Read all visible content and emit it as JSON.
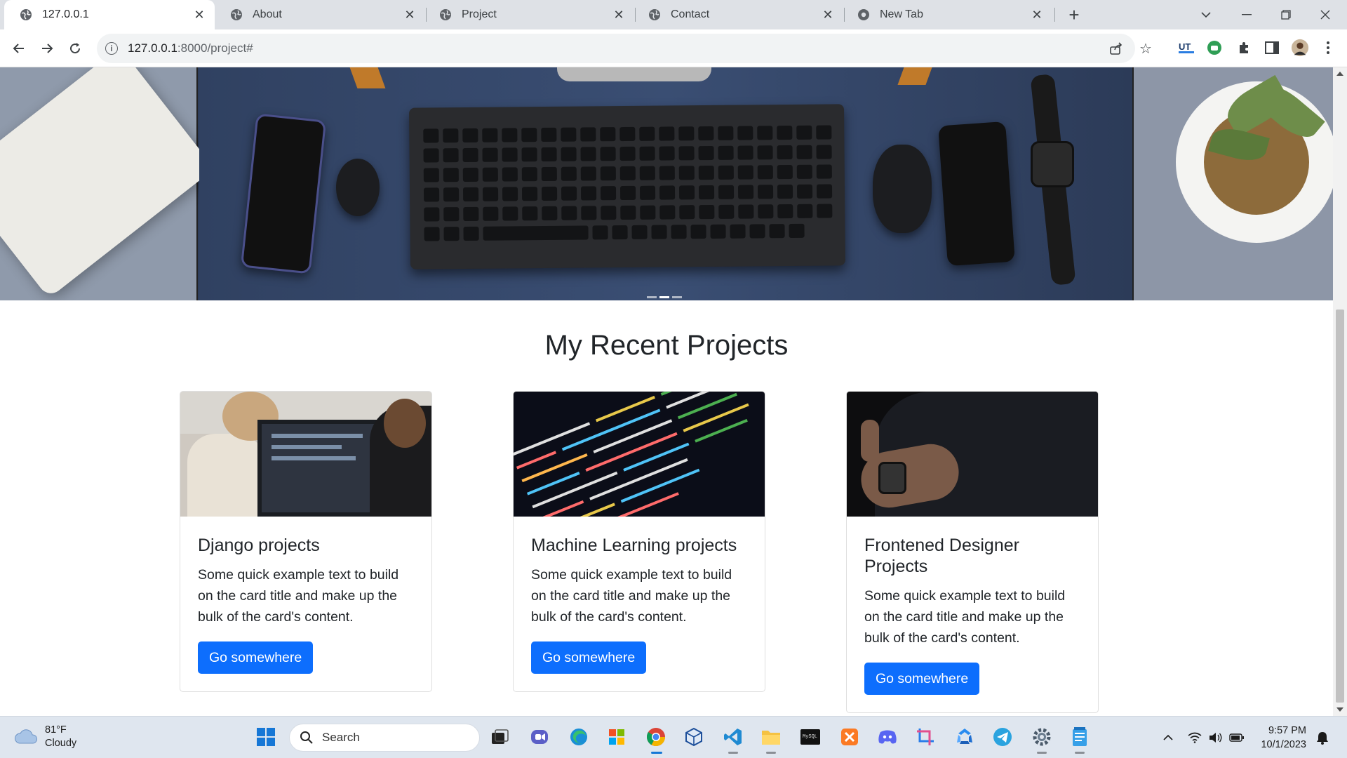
{
  "browser": {
    "tabs": [
      {
        "label": "127.0.0.1",
        "active": true
      },
      {
        "label": "About",
        "active": false
      },
      {
        "label": "Project",
        "active": false
      },
      {
        "label": "Contact",
        "active": false
      },
      {
        "label": "New Tab",
        "active": false
      }
    ],
    "url_host": "127.0.0.1",
    "url_rest": ":8000/project#"
  },
  "page": {
    "section_title": "My Recent Projects",
    "carousel": {
      "slide_count": 3,
      "active_index": 1
    },
    "cards": [
      {
        "title": "Django projects",
        "text": "Some quick example text to build on the card title and make up the bulk of the card's content.",
        "button": "Go somewhere"
      },
      {
        "title": "Machine Learning projects",
        "text": "Some quick example text to build on the card title and make up the bulk of the card's content.",
        "button": "Go somewhere"
      },
      {
        "title": "Frontened Designer Projects",
        "text": "Some quick example text to build on the card title and make up the bulk of the card's content.",
        "button": "Go somewhere"
      }
    ]
  },
  "taskbar": {
    "weather_temp": "81°F",
    "weather_desc": "Cloudy",
    "search_placeholder": "Search",
    "time": "9:57 PM",
    "date": "10/1/2023"
  },
  "colors": {
    "primary_button": "#0d6efd",
    "tabstrip": "#dee1e6",
    "taskbar": "#dfe6ef"
  }
}
